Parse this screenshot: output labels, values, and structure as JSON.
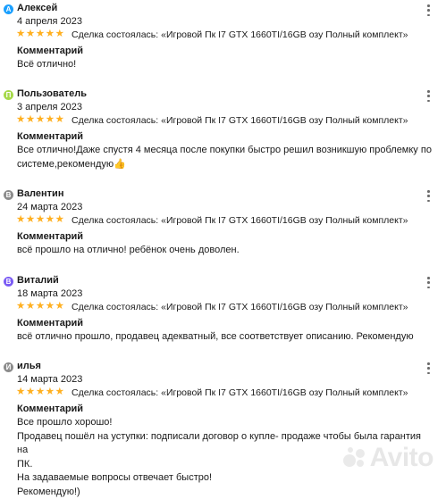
{
  "deal_prefix": "Сделка состоялась: ",
  "colors": {
    "star": "#ffb021",
    "avatar_a": "#1ba0ff",
    "avatar_p": "#a6d94a",
    "avatar_v": "#8c8c8c",
    "avatar_v2": "#7b5cf4",
    "avatar_i": "#8c8c8c"
  },
  "reviews": [
    {
      "initial": "А",
      "author": "Алексей",
      "date": "4 апреля 2023",
      "stars": "★★★★★",
      "rating": 5,
      "deal": "Сделка состоялась: «Игровой Пк I7 GTX 1660TI/16GB озу Полный комплект»",
      "comment_label": "Комментарий",
      "comment": "Всё отлично!"
    },
    {
      "initial": "П",
      "author": "Пользователь",
      "date": "3 апреля 2023",
      "stars": "★★★★★",
      "rating": 5,
      "deal": "Сделка состоялась: «Игровой Пк I7 GTX 1660TI/16GB озу Полный комплект»",
      "comment_label": "Комментарий",
      "comment": "Все отлично!Даже спустя 4 месяца после покупки быстро решил возникшую проблемку по системе,рекомендую👍"
    },
    {
      "initial": "В",
      "author": "Валентин",
      "date": "24 марта 2023",
      "stars": "★★★★★",
      "rating": 5,
      "deal": "Сделка состоялась: «Игровой Пк I7 GTX 1660TI/16GB озу Полный комплект»",
      "comment_label": "Комментарий",
      "comment": "всё прошло на отлично! ребёнок очень доволен."
    },
    {
      "initial": "В",
      "author": "Виталий",
      "date": "18 марта 2023",
      "stars": "★★★★★",
      "rating": 5,
      "deal": "Сделка состоялась: «Игровой Пк I7 GTX 1660TI/16GB озу Полный комплект»",
      "comment_label": "Комментарий",
      "comment": "всё отлично прошло, продавец адекватный, все соответствует описанию. Рекомендую"
    },
    {
      "initial": "И",
      "author": "илья",
      "date": "14 марта 2023",
      "stars": "★★★★★",
      "rating": 5,
      "deal": "Сделка состоялась: «Игровой Пк I7 GTX 1660TI/16GB озу Полный комплект»",
      "comment_label": "Комментарий",
      "comment_lines": [
        "Все прошло хорошо!",
        "Продавец пошёл на уступки: подписали договор о купле- продаже чтобы была гарантия на",
        "ПК.",
        "На задаваемые вопросы отвечает быстро!",
        "Рекомендую!)"
      ]
    }
  ],
  "watermark": {
    "text": "Avito",
    "icon": "avito-logo-dots"
  }
}
